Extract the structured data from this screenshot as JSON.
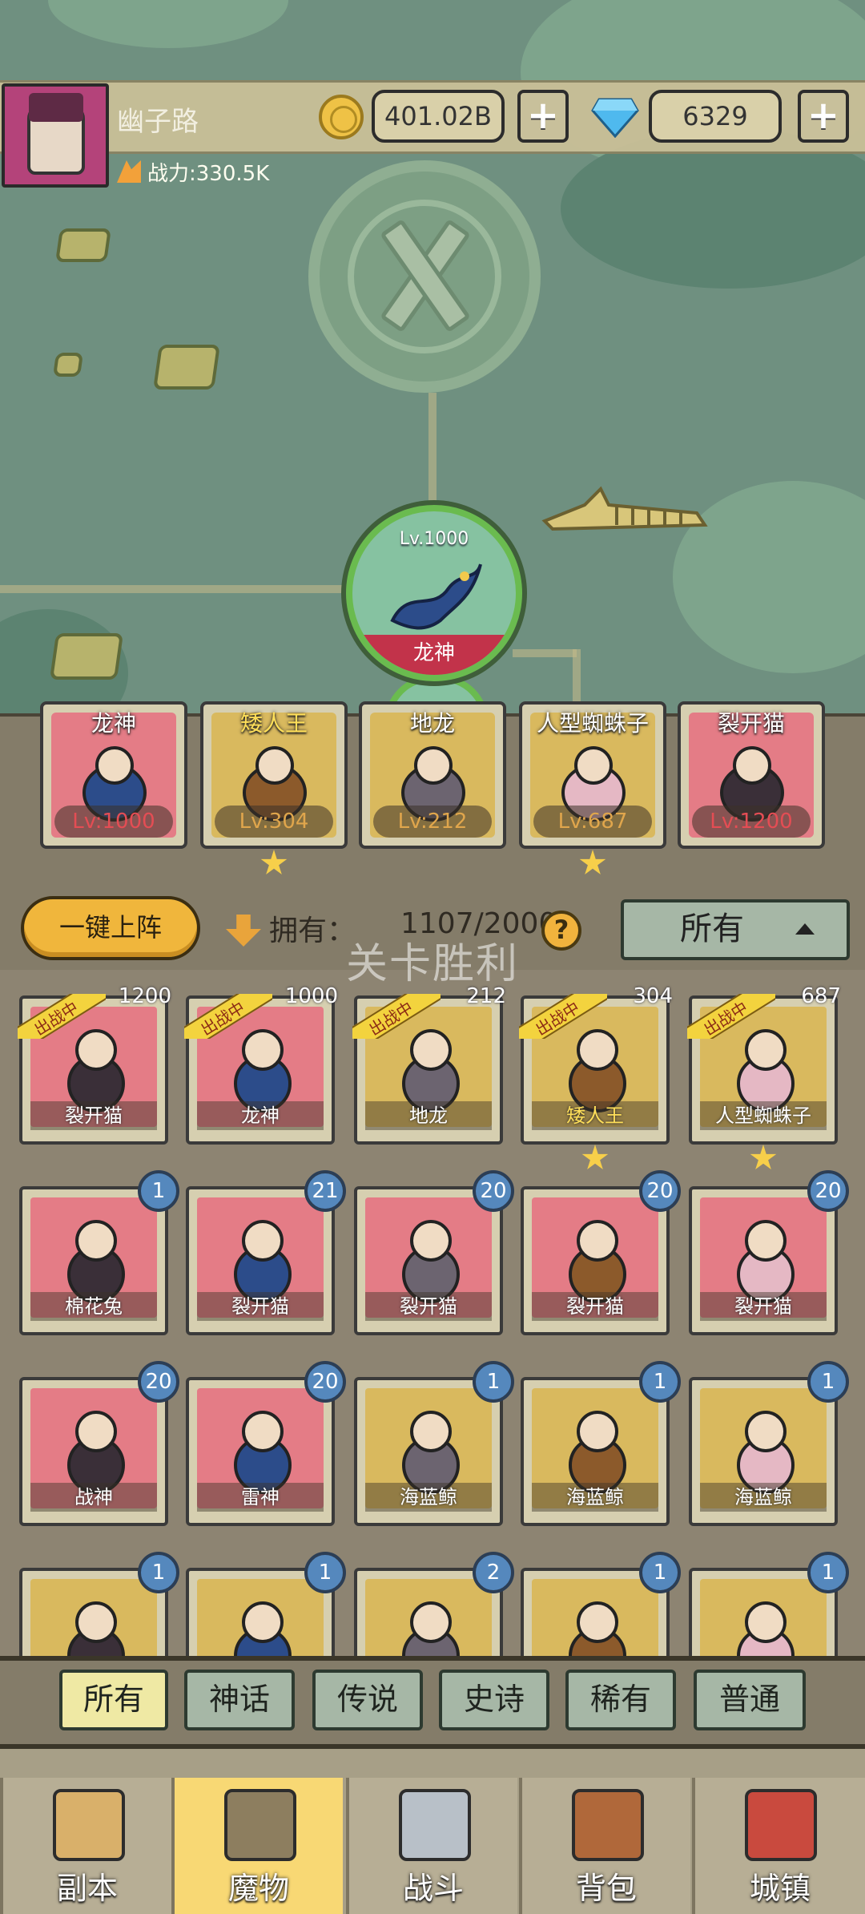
{
  "header": {
    "player_name": "幽子路",
    "power_text": "战力:330.5K",
    "gold": "401.02B",
    "gems": "6329",
    "plus": "+"
  },
  "stage": {
    "level": "Lv.1000",
    "name": "龙神"
  },
  "lineup": [
    {
      "name": "龙神",
      "level": "Lv:1000",
      "star": false,
      "name_color": "white",
      "level_color": "red"
    },
    {
      "name": "矮人王",
      "level": "Lv:304",
      "star": true,
      "name_color": "gold",
      "level_color": "orange"
    },
    {
      "name": "地龙",
      "level": "Lv:212",
      "star": false,
      "name_color": "white",
      "level_color": "orange"
    },
    {
      "name": "人型蜘蛛子",
      "level": "Lv:687",
      "star": true,
      "name_color": "white",
      "level_color": "orange"
    },
    {
      "name": "裂开猫",
      "level": "Lv:1200",
      "star": false,
      "name_color": "white",
      "level_color": "red"
    }
  ],
  "toolbar": {
    "auto_deploy": "一键上阵",
    "owned_label": "拥有：",
    "owned_count": "1107/2000",
    "help": "?",
    "filter_value": "所有"
  },
  "toast": "关卡胜利",
  "roster": [
    {
      "name": "裂开猫",
      "count": "1200",
      "deployed": true,
      "bg": "red"
    },
    {
      "name": "龙神",
      "count": "1000",
      "deployed": true,
      "bg": "red"
    },
    {
      "name": "地龙",
      "count": "212",
      "deployed": true,
      "bg": "gold"
    },
    {
      "name": "矮人王",
      "count": "304",
      "deployed": true,
      "bg": "gold",
      "gold_name": true,
      "star": true
    },
    {
      "name": "人型蜘蛛子",
      "count": "687",
      "deployed": true,
      "bg": "gold",
      "star": true
    },
    {
      "name": "棉花兔",
      "count": "1",
      "bg": "red"
    },
    {
      "name": "裂开猫",
      "count": "21",
      "bg": "red"
    },
    {
      "name": "裂开猫",
      "count": "20",
      "bg": "red"
    },
    {
      "name": "裂开猫",
      "count": "20",
      "bg": "red"
    },
    {
      "name": "裂开猫",
      "count": "20",
      "bg": "red"
    },
    {
      "name": "战神",
      "count": "20",
      "bg": "red"
    },
    {
      "name": "雷神",
      "count": "20",
      "bg": "red"
    },
    {
      "name": "海蓝鲸",
      "count": "1",
      "bg": "gold"
    },
    {
      "name": "海蓝鲸",
      "count": "1",
      "bg": "gold"
    },
    {
      "name": "海蓝鲸",
      "count": "1",
      "bg": "gold"
    },
    {
      "name": "",
      "count": "1",
      "bg": "gold"
    },
    {
      "name": "",
      "count": "1",
      "bg": "gold"
    },
    {
      "name": "",
      "count": "2",
      "bg": "gold"
    },
    {
      "name": "",
      "count": "1",
      "bg": "gold"
    },
    {
      "name": "",
      "count": "1",
      "bg": "gold"
    }
  ],
  "deployed_tag": "出战中",
  "rarity_tabs": [
    "所有",
    "神话",
    "传说",
    "史诗",
    "稀有",
    "普通"
  ],
  "nav": [
    {
      "label": "副本",
      "icon": "map-scroll-icon"
    },
    {
      "label": "魔物",
      "icon": "monster-helmet-icon",
      "active": true
    },
    {
      "label": "战斗",
      "icon": "crossed-swords-icon"
    },
    {
      "label": "背包",
      "icon": "backpack-icon"
    },
    {
      "label": "城镇",
      "icon": "town-shop-icon"
    }
  ],
  "colors": {
    "map_green": "#6f9080",
    "panel_brown": "#847c69",
    "accent_gold": "#f0b63c",
    "card_red": "#e47c86",
    "card_gold": "#d9b95e",
    "badge_blue": "#5588bd",
    "tab_inactive": "#a6b7a6",
    "tab_active": "#efe9a4",
    "nav_active": "#f8d874"
  }
}
